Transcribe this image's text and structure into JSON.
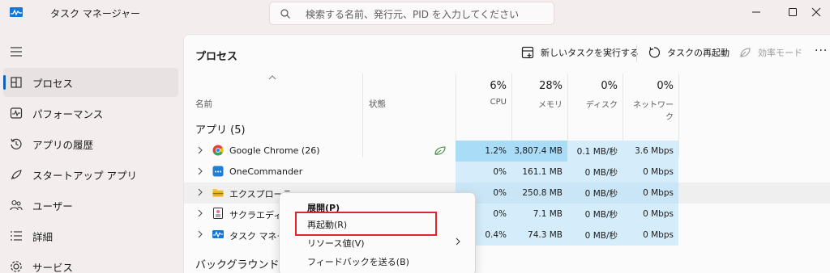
{
  "app": {
    "title": "タスク マネージャー"
  },
  "search": {
    "placeholder": "検索する名前、発行元、PID を入力してください"
  },
  "sidebar": {
    "items": [
      {
        "label": "プロセス",
        "icon": "grid-icon",
        "active": true
      },
      {
        "label": "パフォーマンス",
        "icon": "performance-icon"
      },
      {
        "label": "アプリの履歴",
        "icon": "history-icon"
      },
      {
        "label": "スタートアップ アプリ",
        "icon": "startup-icon"
      },
      {
        "label": "ユーザー",
        "icon": "users-icon"
      },
      {
        "label": "詳細",
        "icon": "details-icon"
      },
      {
        "label": "サービス",
        "icon": "services-icon"
      }
    ]
  },
  "toolbar": {
    "page_title": "プロセス",
    "new_task": "新しいタスクを実行する",
    "restart_task": "タスクの再起動",
    "efficiency_mode": "効率モード",
    "more": "···"
  },
  "table": {
    "columns": {
      "name": "名前",
      "status": "状態",
      "cpu_pct": "6%",
      "cpu": "CPU",
      "mem_pct": "28%",
      "mem": "メモリ",
      "disk_pct": "0%",
      "disk": "ディスク",
      "net_pct": "0%",
      "net": "ネットワーク"
    },
    "section_apps": "アプリ (5)",
    "section_background": "バックグラウンド プ",
    "rows": [
      {
        "name": "Google Chrome (26)",
        "cpu": "1.2%",
        "mem": "3,807.4 MB",
        "disk": "0.1 MB/秒",
        "net": "3.6 Mbps"
      },
      {
        "name": "OneCommander",
        "cpu": "0%",
        "mem": "161.1 MB",
        "disk": "0 MB/秒",
        "net": "0 Mbps"
      },
      {
        "name": "エクスプローラー",
        "cpu": "0%",
        "mem": "250.8 MB",
        "disk": "0 MB/秒",
        "net": "0 Mbps"
      },
      {
        "name": "サクラエディタ (",
        "cpu": "0%",
        "mem": "7.1 MB",
        "disk": "0 MB/秒",
        "net": "0 Mbps"
      },
      {
        "name": "タスク マネージ",
        "cpu": "0.4%",
        "mem": "74.3 MB",
        "disk": "0 MB/秒",
        "net": "0 Mbps"
      }
    ]
  },
  "context_menu": {
    "items": [
      {
        "label": "展開(P)"
      },
      {
        "label": "再起動(R)"
      },
      {
        "label": "リソース値(V)"
      },
      {
        "label": "フィードバックを送る(B)"
      }
    ]
  },
  "colors": {
    "accent": "#0a64b7",
    "cpu_high": "#a9dcf7",
    "cpu_low": "#d5edfb",
    "highlight_box": "#e0242c"
  }
}
